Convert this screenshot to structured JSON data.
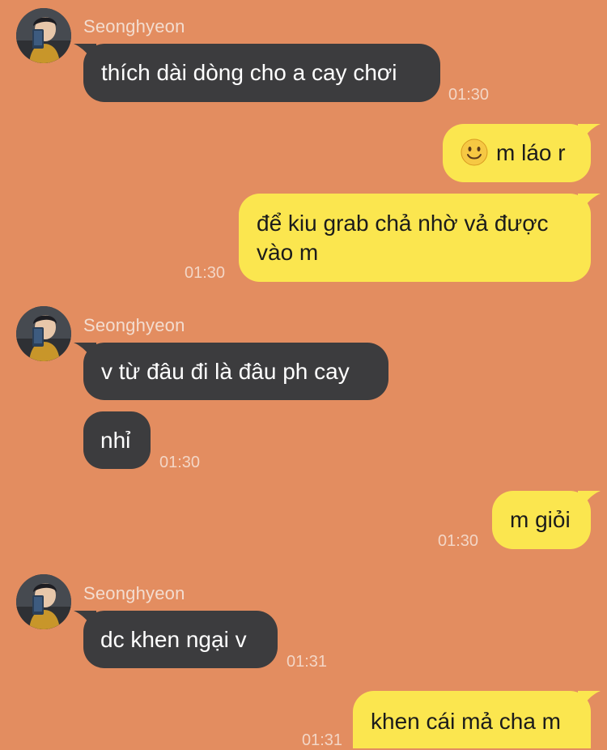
{
  "contact": {
    "name": "Seonghyeon",
    "avatar_icon": "profile-photo"
  },
  "messages": {
    "m1": {
      "text": "thích dài dòng cho a cay chơi",
      "time": "01:30"
    },
    "m2": {
      "text": "m láo r",
      "emoji_icon": "slightly-smiling-face-emoji"
    },
    "m3": {
      "line1": "để kiu grab chả nhờ vả được",
      "line2": "vào m",
      "time": "01:30"
    },
    "m4": {
      "text": "v từ đâu đi là đâu ph cay"
    },
    "m5": {
      "text": "nhỉ",
      "time": "01:30"
    },
    "m6": {
      "text": "m giỏi",
      "time": "01:30"
    },
    "m7": {
      "text": "dc khen ngại v",
      "time": "01:31"
    },
    "m8": {
      "text": "khen cái mả cha m",
      "time": "01:31"
    }
  },
  "colors": {
    "background": "#e38d60",
    "incoming_bubble": "#3c3c3e",
    "outgoing_bubble": "#fbe64f"
  }
}
